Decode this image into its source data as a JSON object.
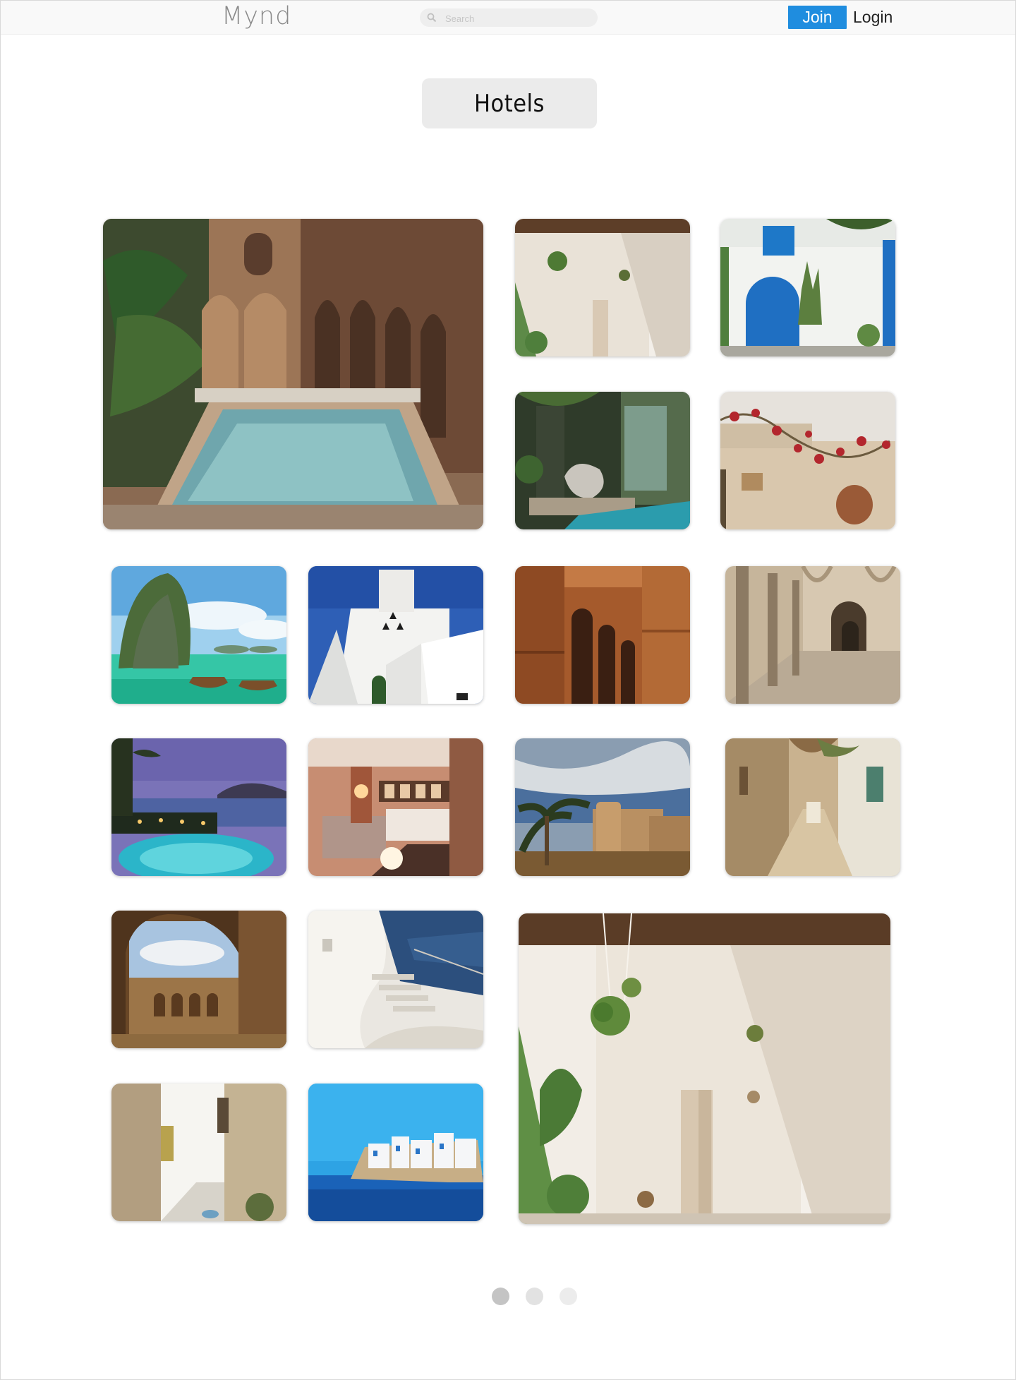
{
  "header": {
    "logo": "Mynd",
    "search_placeholder": "Search",
    "join_label": "Join",
    "login_label": "Login"
  },
  "title": "Hotels",
  "colors": {
    "accent": "#1f8ddf",
    "pill": "#ebebeb",
    "dot_active": "#c4c4c4",
    "dot_inactive": "#e2e2e2"
  },
  "gallery": {
    "photos": [
      "riad-courtyard-pool",
      "white-room-hanging-plants",
      "blue-door-white-house",
      "garden-pool-deck",
      "wall-with-bougainvillea",
      "limestone-island-longtail-boats",
      "white-tower-building",
      "roman-amphitheatre-arches",
      "stone-arcade-corridor",
      "resort-pool-at-dusk",
      "hotel-bedroom",
      "desert-fortress-palms",
      "narrow-medina-alley",
      "amphitheatre-through-archway",
      "white-stairs-by-the-sea",
      "whitewashed-alley",
      "white-town-on-blue-sea",
      "white-room-hanging-plants-large"
    ]
  },
  "pager": {
    "pages": 3,
    "active_page": 1
  }
}
